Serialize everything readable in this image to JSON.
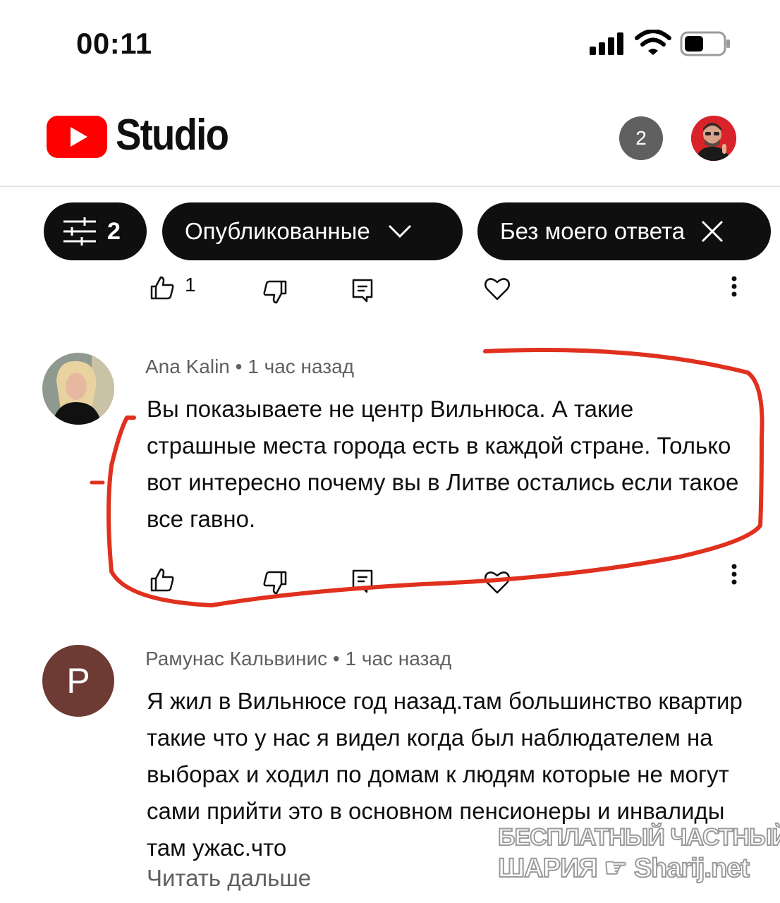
{
  "status_bar": {
    "time": "00:11"
  },
  "header": {
    "studio_label": "Studio",
    "notifications_count": "2"
  },
  "filters": {
    "filter_count": "2",
    "published_label": "Опубликованные",
    "no_reply_label": "Без моего ответа"
  },
  "previous_comment": {
    "like_count": "1"
  },
  "comments": [
    {
      "author": "Ana Kalin",
      "separator": "•",
      "time": "1 час назад",
      "text": "Вы показываете не центр Вильнюса. А такие страшные места города есть в каждой стране. Только вот интересно почему вы в Литве остались если такое все гавно."
    },
    {
      "author": "Рамунас Кальвинис",
      "separator": "•",
      "time": "1 час назад",
      "avatar_letter": "P",
      "text": "Я жил в Вильнюсе год назад.там большинство квартир такие что у нас я видел когда был наблюдателем на выборах и ходил по домам к людям которые не могут сами прийти это в основном пенсионеры и инвалиды там ужас.что",
      "read_more": "Читать дальше"
    }
  ],
  "watermark": {
    "line1": "БЕСПЛАТНЫЙ ЧАСТНЫЙ",
    "line2a": "ШАРИЯ",
    "line2b": "Sharij.net"
  },
  "colors": {
    "brand_red": "#ff0000",
    "chip_bg": "#0f0f0f",
    "annotation_red": "#e0301e",
    "meta_gray": "#606060"
  }
}
